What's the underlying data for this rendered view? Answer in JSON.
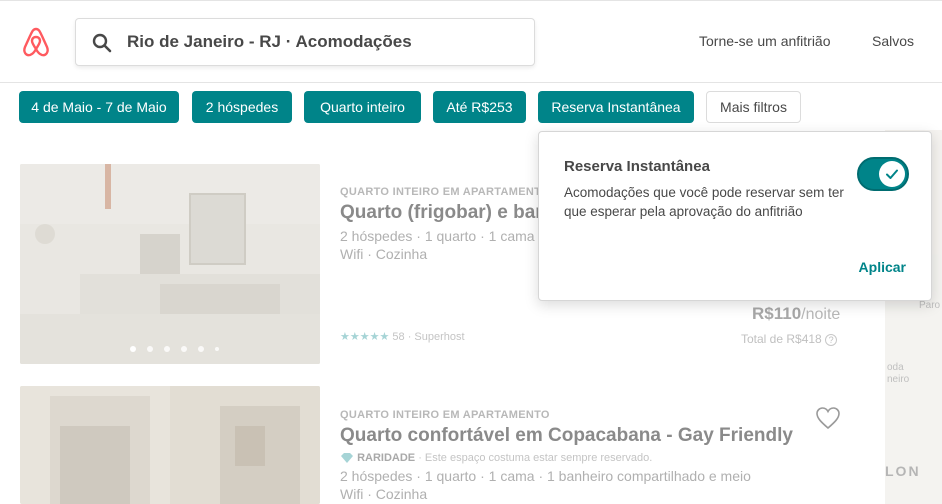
{
  "header": {
    "logo_icon": "airbnb-logo-icon",
    "search": {
      "icon": "search-icon",
      "value": "Rio de Janeiro - RJ · Acomodações"
    },
    "nav": {
      "host": "Torne-se um anfitrião",
      "saved": "Salvos"
    }
  },
  "filters": {
    "dates": "4 de Maio - 7 de Maio",
    "guests": "2 hóspedes",
    "room_type": "Quarto inteiro",
    "price": "Até R$253",
    "instant_book": "Reserva Instantânea",
    "more": "Mais filtros"
  },
  "listings": [
    {
      "kicker": "QUARTO INTEIRO EM APARTAMENTO",
      "title": "Quarto (frigobar) e ban",
      "details": "2 hóspedes · 1 quarto · 1 cama ·",
      "amenities": "Wifi · Cozinha",
      "rating_stars": "★★★★★",
      "reviews": "58",
      "badge": "Superhost",
      "price": "R$110",
      "per": "/noite",
      "total": "Total de R$418",
      "info_icon": "info-icon"
    },
    {
      "kicker": "QUARTO INTEIRO EM APARTAMENTO",
      "title": "Quarto confortável em Copacabana - Gay Friendly",
      "rarity_label": "RARIDADE",
      "rarity_text": "· Este espaço costuma estar sempre reservado.",
      "details": "2 hóspedes · 1 quarto · 1 cama · 1 banheiro compartilhado e meio",
      "amenities": "Wifi · Cozinha",
      "heart_icon": "heart-icon"
    }
  ],
  "map": {
    "labels": [
      "Paro",
      "oda",
      "neiro",
      "LON"
    ]
  },
  "popover": {
    "title": "Reserva Instantânea",
    "description": "Acomodações que você pode reservar sem ter que esperar pela aprovação do anfitrião",
    "toggle_on": true,
    "apply": "Aplicar"
  },
  "colors": {
    "brand": "#FF5A5F",
    "accent": "#008489",
    "text": "#484848"
  }
}
